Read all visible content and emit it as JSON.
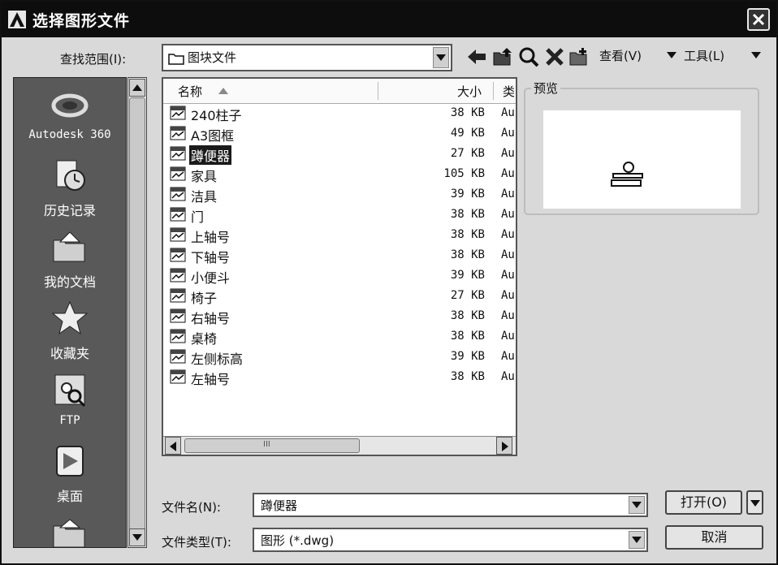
{
  "window": {
    "title": "选择图形文件"
  },
  "lookin": {
    "label": "查找范围(I):",
    "value": "图块文件"
  },
  "toolbar": {
    "view_label": "查看(V)",
    "tools_label": "工具(L)"
  },
  "places": [
    {
      "label": "Autodesk 360"
    },
    {
      "label": "历史记录"
    },
    {
      "label": "我的文档"
    },
    {
      "label": "收藏夹"
    },
    {
      "label": "FTP"
    },
    {
      "label": "桌面"
    }
  ],
  "filelist": {
    "columns": {
      "name": "名称",
      "size": "大小",
      "type": "类"
    },
    "rows": [
      {
        "name": "240柱子",
        "size": "38 KB",
        "type": "Au"
      },
      {
        "name": "A3图框",
        "size": "49 KB",
        "type": "Au"
      },
      {
        "name": "蹲便器",
        "size": "27 KB",
        "type": "Au",
        "selected": true
      },
      {
        "name": "家具",
        "size": "105 KB",
        "type": "Au"
      },
      {
        "name": "洁具",
        "size": "39 KB",
        "type": "Au"
      },
      {
        "name": "门",
        "size": "38 KB",
        "type": "Au"
      },
      {
        "name": "上轴号",
        "size": "38 KB",
        "type": "Au"
      },
      {
        "name": "下轴号",
        "size": "38 KB",
        "type": "Au"
      },
      {
        "name": "小便斗",
        "size": "39 KB",
        "type": "Au"
      },
      {
        "name": "椅子",
        "size": "27 KB",
        "type": "Au"
      },
      {
        "name": "右轴号",
        "size": "38 KB",
        "type": "Au"
      },
      {
        "name": "桌椅",
        "size": "38 KB",
        "type": "Au"
      },
      {
        "name": "左侧标高",
        "size": "39 KB",
        "type": "Au"
      },
      {
        "name": "左轴号",
        "size": "38 KB",
        "type": "Au"
      }
    ]
  },
  "preview": {
    "label": "预览"
  },
  "filename": {
    "label": "文件名(N):",
    "value": "蹲便器"
  },
  "filetype": {
    "label": "文件类型(T):",
    "value": "图形 (*.dwg)"
  },
  "buttons": {
    "open": "打开(O)",
    "cancel": "取消"
  },
  "scrollbar_label": "III"
}
